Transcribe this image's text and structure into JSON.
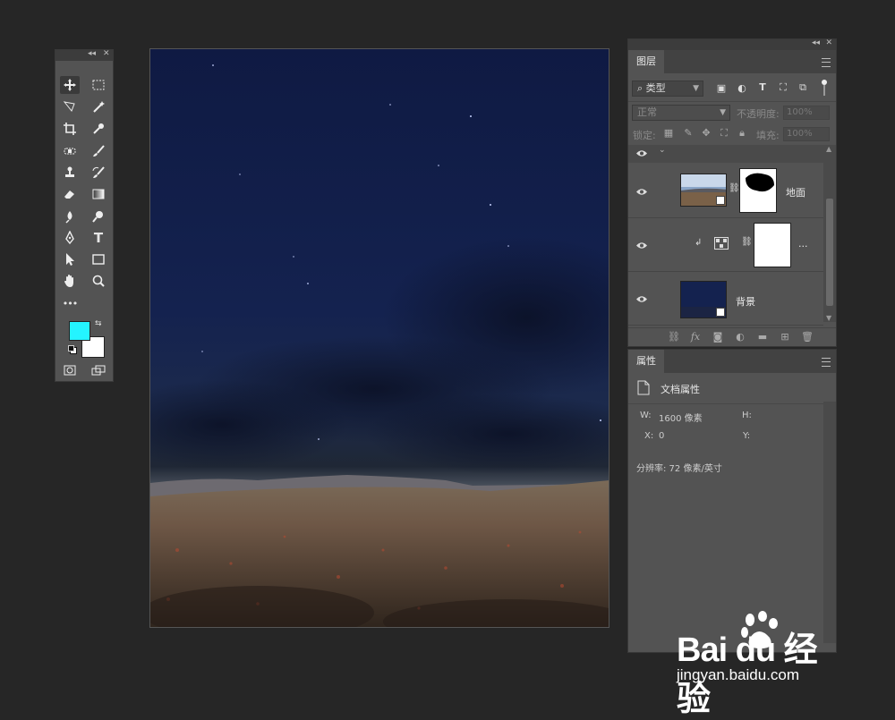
{
  "toolbox": {
    "header_left": "◂◂",
    "header_right": "✕",
    "tools": [
      "move",
      "marquee",
      "lasso",
      "magic-wand",
      "crop",
      "eyedropper",
      "healing",
      "brush",
      "stamp",
      "history-brush",
      "eraser",
      "gradient",
      "blur",
      "dodge",
      "pen",
      "type",
      "path-select",
      "rectangle",
      "hand",
      "zoom",
      "more"
    ],
    "type_tool_glyph": "T",
    "more_glyph": "•••",
    "foreground_color": "#24f4ff",
    "background_color": "#ffffff"
  },
  "layers_panel": {
    "tab": "图层",
    "filter_kind": "类型",
    "blend_mode": "正常",
    "opacity_label": "不透明度:",
    "opacity_value": "100%",
    "lock_label": "锁定:",
    "fill_label": "填充:",
    "fill_value": "100%",
    "layers": [
      {
        "name": "地面",
        "has_mask": true,
        "kind": "smart-object"
      },
      {
        "name": "...",
        "kind": "adjustment",
        "clipped": true
      },
      {
        "name": "背景",
        "kind": "smart-object"
      }
    ]
  },
  "properties_panel": {
    "tab": "属性",
    "section_title": "文档属性",
    "w_label": "W:",
    "w_value": "1600 像素",
    "h_label": "H:",
    "h_value": "",
    "x_label": "X:",
    "x_value": "0",
    "y_label": "Y:",
    "y_value": "",
    "resolution": "分辨率: 72 像素/英寸"
  },
  "watermark": {
    "logo": "Bai du 经验",
    "url": "jingyan.baidu.com"
  }
}
